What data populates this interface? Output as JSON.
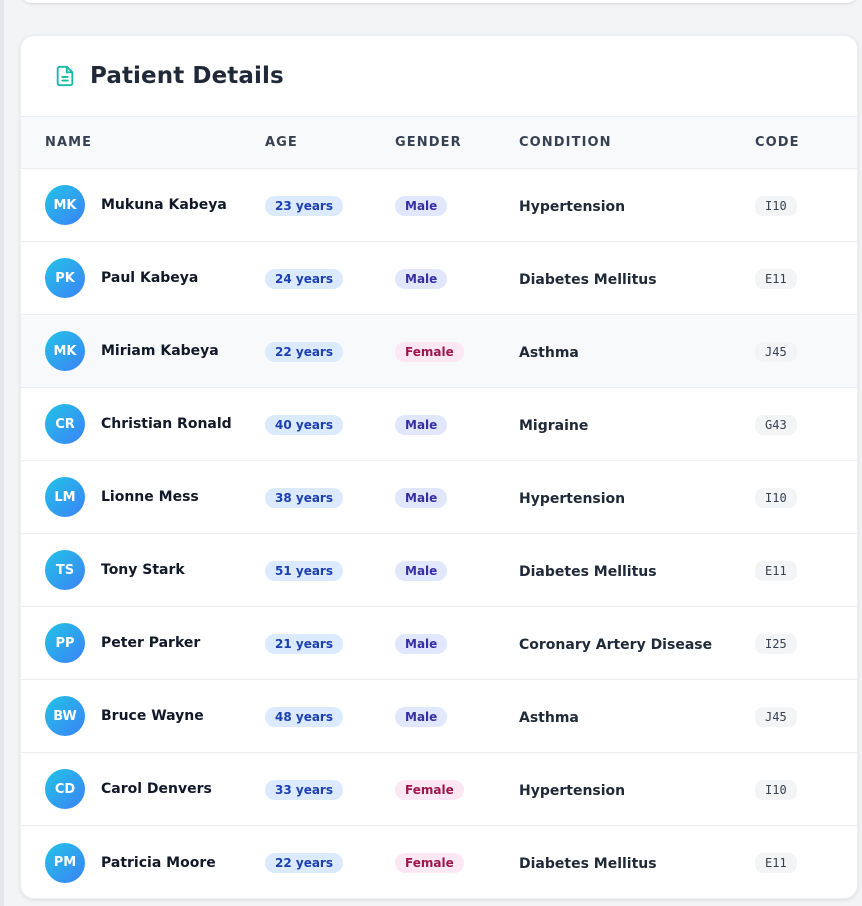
{
  "card": {
    "title": "Patient Details",
    "icon": "document-icon",
    "accent_color": "#14b8a6"
  },
  "columns": {
    "name": "NAME",
    "age": "AGE",
    "gender": "GENDER",
    "condition": "CONDITION",
    "code": "CODE"
  },
  "patients": [
    {
      "initials": "MK",
      "name": "Mukuna Kabeya",
      "age": "23 years",
      "gender": "Male",
      "condition": "Hypertension",
      "code": "I10"
    },
    {
      "initials": "PK",
      "name": "Paul Kabeya",
      "age": "24 years",
      "gender": "Male",
      "condition": "Diabetes Mellitus",
      "code": "E11"
    },
    {
      "initials": "MK",
      "name": "Miriam Kabeya",
      "age": "22 years",
      "gender": "Female",
      "condition": "Asthma",
      "code": "J45"
    },
    {
      "initials": "CR",
      "name": "Christian Ronald",
      "age": "40 years",
      "gender": "Male",
      "condition": "Migraine",
      "code": "G43"
    },
    {
      "initials": "LM",
      "name": "Lionne Mess",
      "age": "38 years",
      "gender": "Male",
      "condition": "Hypertension",
      "code": "I10"
    },
    {
      "initials": "TS",
      "name": "Tony Stark",
      "age": "51 years",
      "gender": "Male",
      "condition": "Diabetes Mellitus",
      "code": "E11"
    },
    {
      "initials": "PP",
      "name": "Peter Parker",
      "age": "21 years",
      "gender": "Male",
      "condition": "Coronary Artery Disease",
      "code": "I25"
    },
    {
      "initials": "BW",
      "name": "Bruce Wayne",
      "age": "48 years",
      "gender": "Male",
      "condition": "Asthma",
      "code": "J45"
    },
    {
      "initials": "CD",
      "name": "Carol Denvers",
      "age": "33 years",
      "gender": "Female",
      "condition": "Hypertension",
      "code": "I10"
    },
    {
      "initials": "PM",
      "name": "Patricia Moore",
      "age": "22 years",
      "gender": "Female",
      "condition": "Diabetes Mellitus",
      "code": "E11"
    }
  ]
}
